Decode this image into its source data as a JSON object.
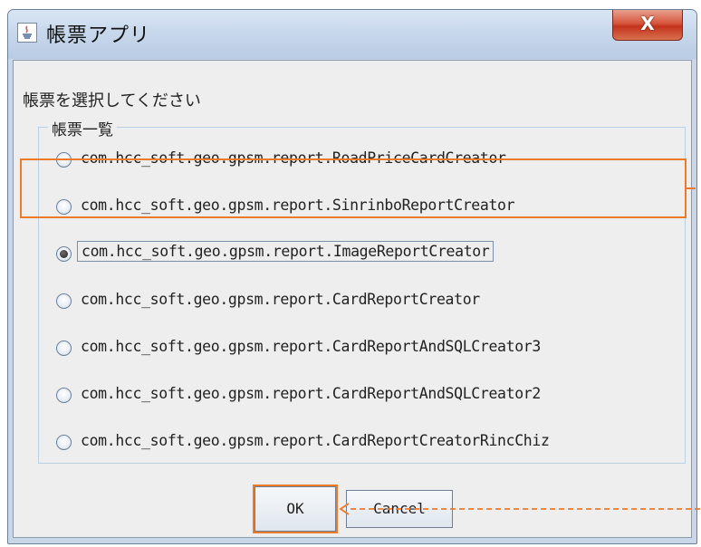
{
  "window": {
    "title": "帳票アプリ",
    "close_label": "X"
  },
  "prompt": "帳票を選択してください",
  "group": {
    "title": "帳票一覧",
    "options": [
      {
        "label": "com.hcc_soft.geo.gpsm.report.RoadPriceCardCreator",
        "checked": false
      },
      {
        "label": "com.hcc_soft.geo.gpsm.report.SinrinboReportCreator",
        "checked": false
      },
      {
        "label": "com.hcc_soft.geo.gpsm.report.ImageReportCreator",
        "checked": true
      },
      {
        "label": "com.hcc_soft.geo.gpsm.report.CardReportCreator",
        "checked": false
      },
      {
        "label": "com.hcc_soft.geo.gpsm.report.CardReportAndSQLCreator3",
        "checked": false
      },
      {
        "label": "com.hcc_soft.geo.gpsm.report.CardReportAndSQLCreator2",
        "checked": false
      },
      {
        "label": "com.hcc_soft.geo.gpsm.report.CardReportCreatorRincChiz",
        "checked": false
      }
    ]
  },
  "buttons": {
    "ok": "OK",
    "cancel": "Cancel"
  },
  "colors": {
    "annotation": "#ec7a2b",
    "close_button": "#c3331c"
  }
}
